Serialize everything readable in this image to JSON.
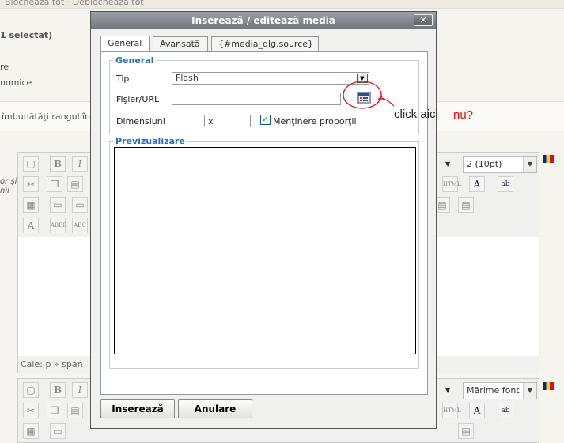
{
  "background": {
    "top_text": "Blocheaza tot · Deblocheaza tot",
    "selected": "1 selectat)",
    "side1": "re",
    "side2": "nomice",
    "band_text": "îmbunătăţi rangul în",
    "left_note1": "or și",
    "left_note2": "nii",
    "editor1": {
      "font_size": "2 (10pt)",
      "path": "Cale: p » span"
    },
    "editor2": {
      "font_size": "Mărime font"
    }
  },
  "dialog": {
    "title": "Inserează / editează media",
    "close": "✕",
    "tabs": [
      {
        "label": "General"
      },
      {
        "label": "Avansată"
      },
      {
        "label": "{#media_dlg.source}"
      }
    ],
    "general": {
      "legend": "General",
      "type_label": "Tip",
      "type_value": "Flash",
      "file_label": "Fişier/URL",
      "file_value": "",
      "dimensions_label": "Dimensiuni",
      "times": "x",
      "width_value": "",
      "height_value": "",
      "constrain_label": "Menţinere proporţii",
      "constrain_checked": "✓"
    },
    "preview_legend": "Previzualizare",
    "insert_button": "Inserează",
    "cancel_button": "Anulare"
  },
  "annotation": {
    "click_here": "click aici",
    "no": "nu?"
  }
}
